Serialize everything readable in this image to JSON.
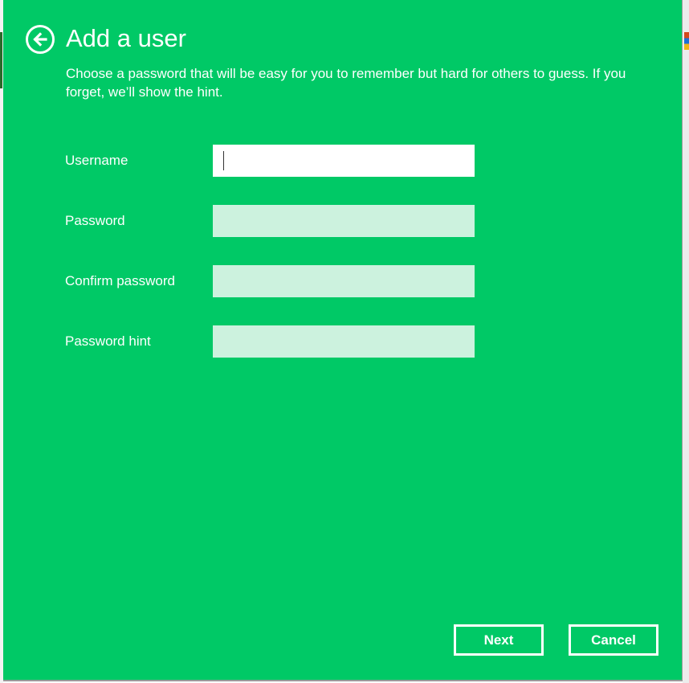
{
  "dialog": {
    "title": "Add a user",
    "description": "Choose a password that will be easy for you to remember but hard for others to guess. If you forget, we’ll show the hint.",
    "back_icon": "arrow-left-circle-icon",
    "background_color": "#00c966"
  },
  "form": {
    "username": {
      "label": "Username",
      "value": ""
    },
    "password": {
      "label": "Password",
      "value": ""
    },
    "confirm_password": {
      "label": "Confirm password",
      "value": ""
    },
    "password_hint": {
      "label": "Password hint",
      "value": ""
    }
  },
  "buttons": {
    "next_label": "Next",
    "cancel_label": "Cancel"
  }
}
